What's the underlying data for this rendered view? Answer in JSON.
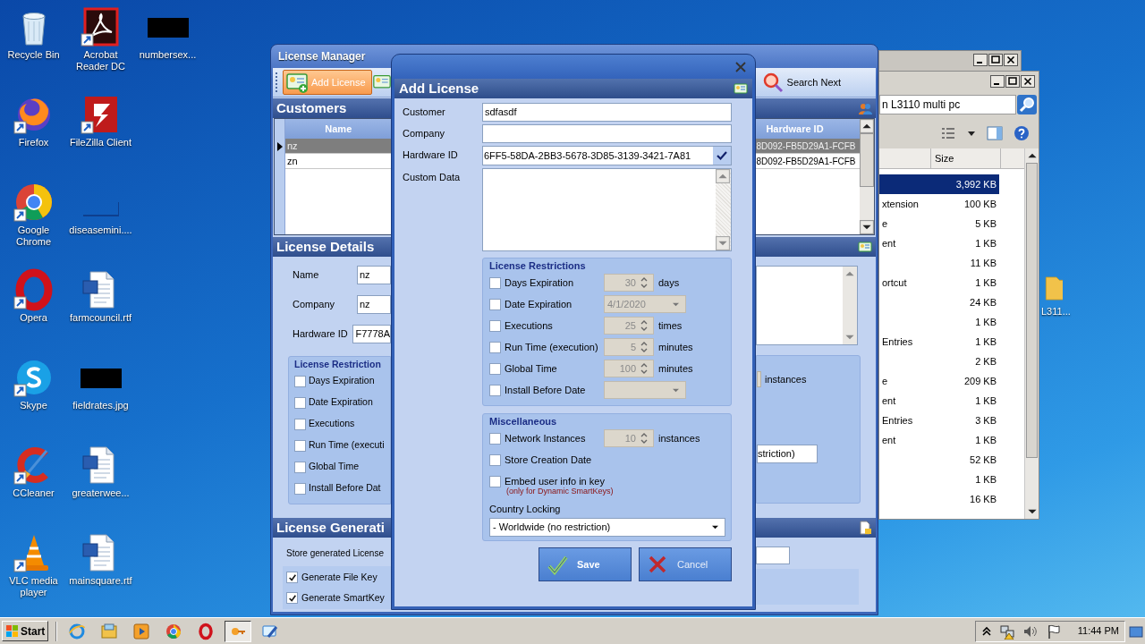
{
  "desktop": {
    "columns": [
      [
        {
          "label": "Recycle Bin",
          "kind": "recycle",
          "shortcut": false
        },
        {
          "label": "Firefox",
          "kind": "firefox",
          "shortcut": true
        },
        {
          "label": "Google Chrome",
          "kind": "chrome",
          "shortcut": true
        },
        {
          "label": "Opera",
          "kind": "opera",
          "shortcut": true
        },
        {
          "label": "Skype",
          "kind": "skype",
          "shortcut": true
        },
        {
          "label": "CCleaner",
          "kind": "ccleaner",
          "shortcut": true
        },
        {
          "label": "VLC media player",
          "kind": "vlc",
          "shortcut": true
        }
      ],
      [
        {
          "label": "Acrobat Reader DC",
          "kind": "acrobat",
          "shortcut": true
        },
        {
          "label": "FileZilla Client",
          "kind": "filezilla",
          "shortcut": true
        },
        {
          "label": "diseasemini....",
          "kind": "blank",
          "shortcut": false
        },
        {
          "label": "farmcouncil.rtf",
          "kind": "word",
          "shortcut": false
        },
        {
          "label": "fieldrates.jpg",
          "kind": "redacted",
          "shortcut": false
        },
        {
          "label": "greaterwee...",
          "kind": "word",
          "shortcut": false
        },
        {
          "label": "mainsquare.rtf",
          "kind": "word",
          "shortcut": false
        }
      ],
      [
        {
          "label": "numbersex...",
          "kind": "redacted",
          "shortcut": false
        }
      ]
    ],
    "partial_icon": {
      "label": "L311...",
      "kind": "folder"
    }
  },
  "explorer": {
    "search": {
      "value": "n L3110 multi pc"
    },
    "columns": [
      "Size"
    ],
    "rows": [
      {
        "size": "3,992 KB",
        "selected": true
      },
      {
        "name": "xtension",
        "size": "100 KB",
        "selected": false
      },
      {
        "name": "e",
        "size": "5 KB",
        "selected": false
      },
      {
        "name": "ent",
        "size": "1 KB",
        "selected": false
      },
      {
        "size": "11 KB",
        "selected": false
      },
      {
        "name": "ortcut",
        "size": "1 KB",
        "selected": false
      },
      {
        "size": "24 KB",
        "selected": false
      },
      {
        "size": "1 KB",
        "selected": false
      },
      {
        "name": "Entries",
        "size": "1 KB",
        "selected": false
      },
      {
        "size": "2 KB",
        "selected": false
      },
      {
        "name": "e",
        "size": "209 KB",
        "selected": false
      },
      {
        "name": "ent",
        "size": "1 KB",
        "selected": false
      },
      {
        "name": "Entries",
        "size": "3 KB",
        "selected": false
      },
      {
        "name": "ent",
        "size": "1 KB",
        "selected": false
      },
      {
        "size": "52 KB",
        "selected": false
      },
      {
        "size": "1 KB",
        "selected": false
      },
      {
        "size": "16 KB",
        "selected": false
      }
    ]
  },
  "license_manager": {
    "title": "License Manager",
    "toolbar": [
      {
        "label": "Add License",
        "kind": "add",
        "highlighted": true
      },
      {
        "kind": "edit",
        "highlighted": false
      },
      {
        "label": "Search Next",
        "kind": "search",
        "highlighted": false
      }
    ],
    "customers": {
      "title": "Customers",
      "columns": [
        "Name",
        "Hardware ID"
      ],
      "rows": [
        {
          "name": "nz",
          "hardware_id": "8D092-FB5D29A1-FCFB",
          "selected": true
        },
        {
          "name": "zn",
          "hardware_id": "8D092-FB5D29A1-FCFB",
          "selected": false
        }
      ]
    },
    "license_details": {
      "title": "License Details",
      "fields": [
        {
          "label": "Name",
          "value": "nz"
        },
        {
          "label": "Company",
          "value": "nz"
        },
        {
          "label": "Hardware ID",
          "value": "F7778A"
        }
      ],
      "restrictions": {
        "title": "License Restriction",
        "items": [
          {
            "label": "Days Expiration",
            "checked": false
          },
          {
            "label": "Date Expiration",
            "checked": false
          },
          {
            "label": "Executions",
            "checked": false
          },
          {
            "label": "Run Time (executi",
            "checked": false
          },
          {
            "label": "Global Time",
            "checked": false
          },
          {
            "label": "Install Before Dat",
            "checked": false
          }
        ]
      },
      "instances_unit": "instances",
      "country_value": "striction)"
    },
    "license_generation": {
      "title": "License Generati",
      "store_label": "Store generated License",
      "options": [
        {
          "label": "Generate File Key",
          "checked": true
        },
        {
          "label": "Generate SmartKey",
          "checked": true
        }
      ]
    }
  },
  "add_license": {
    "title": "Add License",
    "fields": [
      {
        "label": "Customer",
        "value": "sdfasdf",
        "kind": "text"
      },
      {
        "label": "Company",
        "kind": "text"
      },
      {
        "label": "Hardware ID",
        "value": "6FF5-58DA-2BB3-5678-3D85-3139-3421-7A81",
        "kind": "validate"
      },
      {
        "label": "Custom Data",
        "kind": "multiline"
      }
    ],
    "restrictions": {
      "title": "License Restrictions",
      "items": [
        {
          "label": "Days Expiration",
          "checked": false,
          "kind": "spin",
          "value": "30",
          "unit": "days",
          "disabled": true
        },
        {
          "label": "Date Expiration",
          "checked": false,
          "kind": "date",
          "value": "4/1/2020",
          "disabled": true
        },
        {
          "label": "Executions",
          "checked": false,
          "kind": "spin",
          "value": "25",
          "unit": "times",
          "disabled": true
        },
        {
          "label": "Run Time (execution)",
          "checked": false,
          "kind": "spin",
          "value": "5",
          "unit": "minutes",
          "disabled": true
        },
        {
          "label": "Global Time",
          "checked": false,
          "kind": "spin",
          "value": "100",
          "unit": "minutes",
          "disabled": true
        },
        {
          "label": "Install Before Date",
          "checked": false,
          "kind": "date",
          "disabled": true
        }
      ]
    },
    "miscellaneous": {
      "title": "Miscellaneous",
      "items": [
        {
          "label": "Network Instances",
          "checked": false,
          "kind": "spin",
          "value": "10",
          "unit": "instances",
          "disabled": true
        },
        {
          "label": "Store Creation Date",
          "checked": false,
          "kind": "plain"
        },
        {
          "label": "Embed user info in key",
          "checked": false,
          "kind": "plain",
          "note": "(only for Dynamic SmartKeys)"
        }
      ],
      "country_label": "Country Locking",
      "country_value": "- Worldwide (no restriction)"
    },
    "buttons": [
      {
        "label": "Save",
        "kind": "save"
      },
      {
        "label": "Cancel",
        "kind": "cancel"
      }
    ]
  },
  "taskbar": {
    "start": "Start",
    "apps": [
      {
        "kind": "ie",
        "active": false
      },
      {
        "kind": "explorer",
        "active": false
      },
      {
        "kind": "media",
        "active": false
      },
      {
        "kind": "chrome",
        "active": false
      },
      {
        "kind": "opera",
        "active": false
      },
      {
        "kind": "license",
        "active": true
      },
      {
        "kind": "dialog",
        "active": false
      }
    ],
    "clock": "11:44 PM"
  }
}
